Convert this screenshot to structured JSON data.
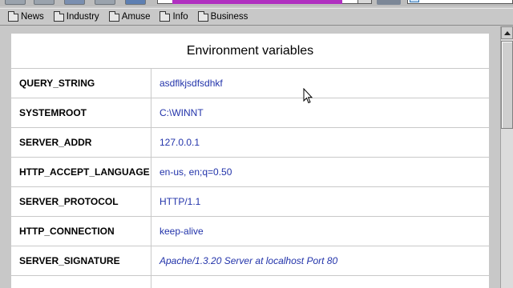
{
  "bookmarks": [
    {
      "label": "News",
      "icon": "folder-icon"
    },
    {
      "label": "Industry",
      "icon": "folder-icon"
    },
    {
      "label": "Amuse",
      "icon": "folder-icon"
    },
    {
      "label": "Info",
      "icon": "folder-icon"
    },
    {
      "label": "Business",
      "icon": "folder-icon"
    }
  ],
  "table": {
    "title": "Environment variables",
    "rows": [
      {
        "name": "QUERY_STRING",
        "value": "asdflkjsdfsdhkf"
      },
      {
        "name": "SYSTEMROOT",
        "value": "C:\\WINNT"
      },
      {
        "name": "SERVER_ADDR",
        "value": "127.0.0.1"
      },
      {
        "name": "HTTP_ACCEPT_LANGUAGE",
        "value": "en-us, en;q=0.50"
      },
      {
        "name": "SERVER_PROTOCOL",
        "value": "HTTP/1.1"
      },
      {
        "name": "HTTP_CONNECTION",
        "value": "keep-alive"
      },
      {
        "name": "SERVER_SIGNATURE",
        "value": "Apache/1.3.20 Server at localhost Port 80"
      }
    ]
  },
  "colors": {
    "value_text": "#2233aa",
    "url_highlight": "#b030c0",
    "chrome": "#c8c8c8"
  }
}
